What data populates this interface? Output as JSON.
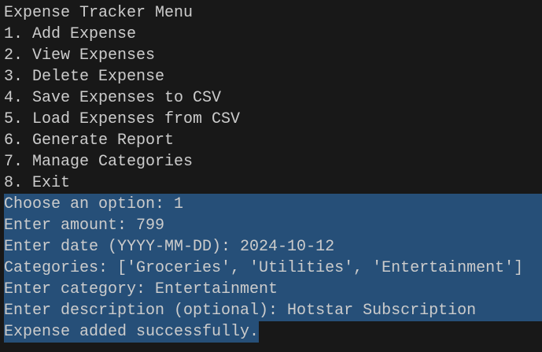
{
  "menu": {
    "title": "Expense Tracker Menu",
    "options": [
      "1. Add Expense",
      "2. View Expenses",
      "3. Delete Expense",
      "4. Save Expenses to CSV",
      "5. Load Expenses from CSV",
      "6. Generate Report",
      "7. Manage Categories",
      "8. Exit"
    ]
  },
  "session": [
    "Choose an option: 1",
    "Enter amount: 799",
    "Enter date (YYYY-MM-DD): 2024-10-12",
    "Categories: ['Groceries', 'Utilities', 'Entertainment']",
    "Enter category: Entertainment",
    "Enter description (optional): Hotstar Subscription"
  ],
  "result": "Expense added successfully.",
  "colors": {
    "background": "#181818",
    "text": "#cccccc",
    "selection": "#264f78"
  }
}
